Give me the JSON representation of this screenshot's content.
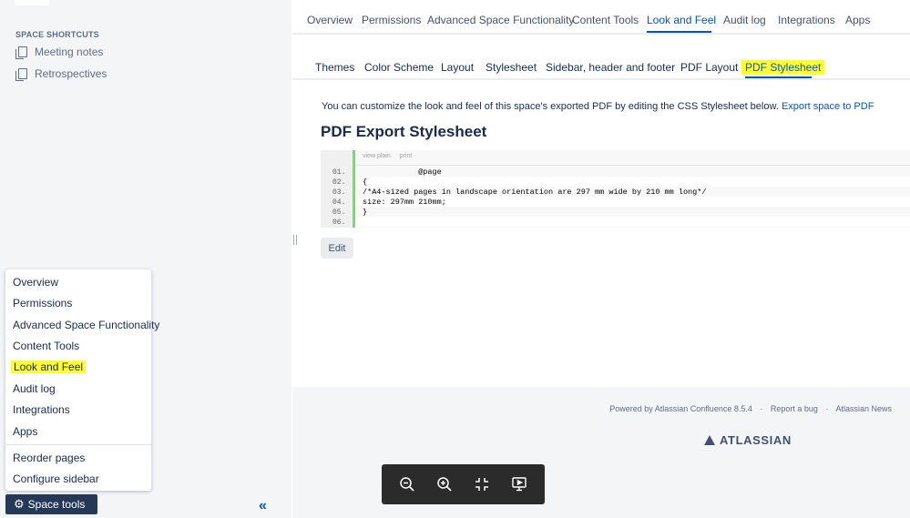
{
  "sidebar": {
    "shortcuts_title": "SPACE SHORTCUTS",
    "shortcuts": [
      {
        "label": "Meeting notes"
      },
      {
        "label": "Retrospectives"
      }
    ],
    "menu": [
      {
        "label": "Overview"
      },
      {
        "label": "Permissions"
      },
      {
        "label": "Advanced Space Functionality"
      },
      {
        "label": "Content Tools"
      },
      {
        "label": "Look and Feel"
      },
      {
        "label": "Audit log"
      },
      {
        "label": "Integrations"
      },
      {
        "label": "Apps"
      },
      {
        "label": "Reorder pages"
      },
      {
        "label": "Configure sidebar"
      }
    ],
    "space_tools_label": "Space tools",
    "collapse_glyph": "«"
  },
  "top_tabs": [
    {
      "label": "Overview"
    },
    {
      "label": "Permissions"
    },
    {
      "label": "Advanced Space Functionality"
    },
    {
      "label": "Content Tools"
    },
    {
      "label": "Look and Feel"
    },
    {
      "label": "Audit log"
    },
    {
      "label": "Integrations"
    },
    {
      "label": "Apps"
    }
  ],
  "sub_tabs": [
    {
      "label": "Themes"
    },
    {
      "label": "Color Scheme"
    },
    {
      "label": "Layout"
    },
    {
      "label": "Stylesheet"
    },
    {
      "label": "Sidebar, header and footer"
    },
    {
      "label": "PDF Layout"
    },
    {
      "label": "PDF Stylesheet"
    }
  ],
  "content": {
    "intro_text": "You can customize the look and feel of this space's exported PDF by editing the CSS Stylesheet below.",
    "intro_link": "Export space to PDF",
    "heading": "PDF Export Stylesheet",
    "code_toolbar": {
      "view_plain": "view plain",
      "print": "print"
    },
    "code_lines": [
      {
        "num": "01.",
        "text": "            @page"
      },
      {
        "num": "02.",
        "text": "{"
      },
      {
        "num": "03.",
        "text": "/*A4-sized pages in landscape orientation are 297 mm wide by 210 mm long*/"
      },
      {
        "num": "04.",
        "text": "size: 297mm 210mm;"
      },
      {
        "num": "05.",
        "text": "}"
      },
      {
        "num": "06.",
        "text": ""
      }
    ],
    "edit_label": "Edit"
  },
  "footer": {
    "powered_by": "Powered by Atlassian Confluence 8.5.4",
    "report_bug": "Report a bug",
    "news": "Atlassian News",
    "separator": "·",
    "logo_text": "ATLASSIAN"
  },
  "viewer_toolbar": {
    "icons": [
      "zoom-out-icon",
      "zoom-in-icon",
      "fit-screen-icon",
      "present-icon"
    ]
  },
  "colors": {
    "highlight": "#ffff2e",
    "link": "#0052cc",
    "sidebar_bg": "#f4f5f7",
    "space_tools_bg": "#253858",
    "code_bar": "#6ce26c"
  }
}
